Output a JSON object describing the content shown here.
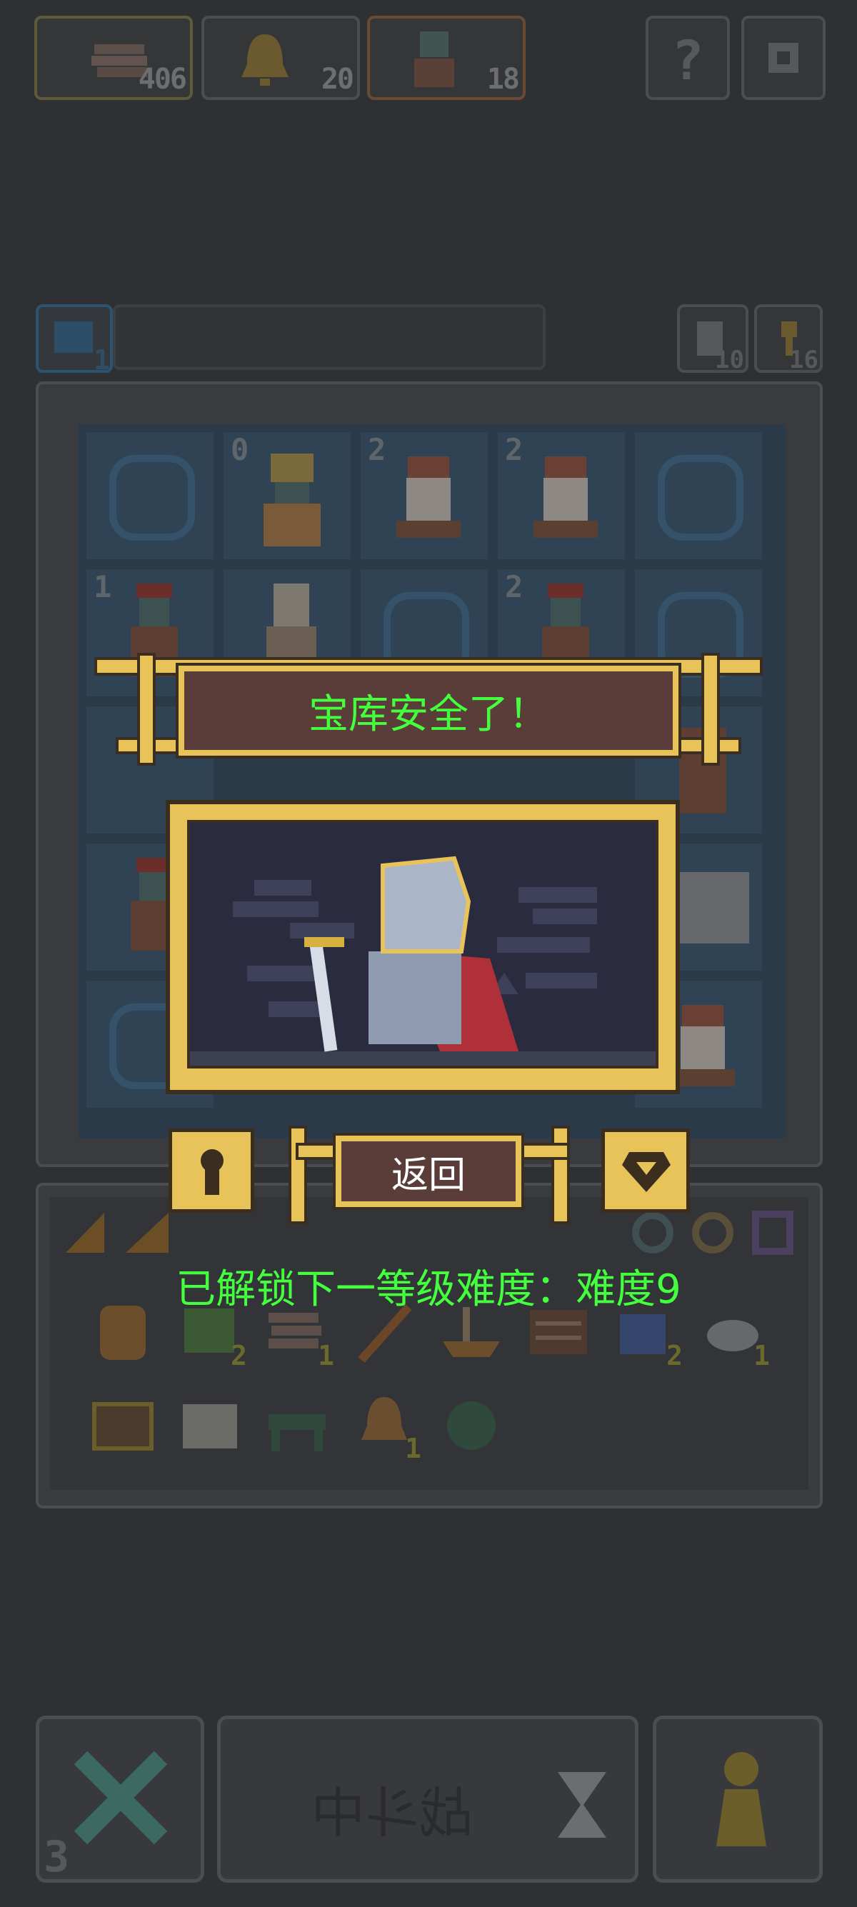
{
  "resources": [
    {
      "icon": "wood-plank-icon",
      "count": "406"
    },
    {
      "icon": "bell-icon",
      "count": "20"
    },
    {
      "icon": "goblin-hero-icon",
      "count": "18"
    }
  ],
  "top_right": {
    "help_icon": "question-mark-icon",
    "settings_icon": "gear-icon"
  },
  "board_header": {
    "left_badge": "1",
    "right_counters": [
      {
        "icon": "door-icon",
        "count": "10"
      },
      {
        "icon": "key-icon",
        "count": "16"
      }
    ]
  },
  "board": {
    "cells": [
      {
        "unit": "",
        "level": ""
      },
      {
        "unit": "golden-warrior",
        "level": "0"
      },
      {
        "unit": "bearded-dwarf",
        "level": "2"
      },
      {
        "unit": "bearded-dwarf",
        "level": "2"
      },
      {
        "unit": "",
        "level": ""
      },
      {
        "unit": "goblin-archer",
        "level": "1"
      },
      {
        "unit": "priestess",
        "level": ""
      },
      {
        "unit": "",
        "level": ""
      },
      {
        "unit": "goblin-archer",
        "level": "2"
      },
      {
        "unit": "",
        "level": ""
      }
    ]
  },
  "overlay": {
    "title": "宝库安全了！",
    "back_label": "返回",
    "unlock_text": "已解锁下一等级难度：难度9",
    "left_button_icon": "keyhole-icon",
    "right_button_icon": "gem-icon"
  },
  "inventory": {
    "items": [
      {
        "icon": "shield-mask-icon",
        "count": ""
      },
      {
        "icon": "green-leaf-icon",
        "count": "2"
      },
      {
        "icon": "wood-plank-icon",
        "count": "1"
      },
      {
        "icon": "staff-icon",
        "count": ""
      },
      {
        "icon": "ship-icon",
        "count": ""
      },
      {
        "icon": "crate-icon",
        "count": ""
      },
      {
        "icon": "blueprint-icon",
        "count": "2"
      },
      {
        "icon": "cloud-icon",
        "count": "1"
      },
      {
        "icon": "treasure-box-icon",
        "count": ""
      },
      {
        "icon": "scroll-icon",
        "count": ""
      },
      {
        "icon": "bench-icon",
        "count": ""
      },
      {
        "icon": "bell-icon",
        "count": "1"
      },
      {
        "icon": "green-orb-icon",
        "count": ""
      }
    ]
  },
  "bottom": {
    "left_count": "3",
    "battle_label": "战斗中",
    "cancel_icon": "cross-icon",
    "hourglass_icon": "hourglass-icon",
    "pawn_icon": "pawn-icon"
  },
  "colors": {
    "background": "#2f3033",
    "accent_gold": "#e8c35a",
    "plate": "#5a3c38",
    "highlight_text": "#43ff3d"
  }
}
